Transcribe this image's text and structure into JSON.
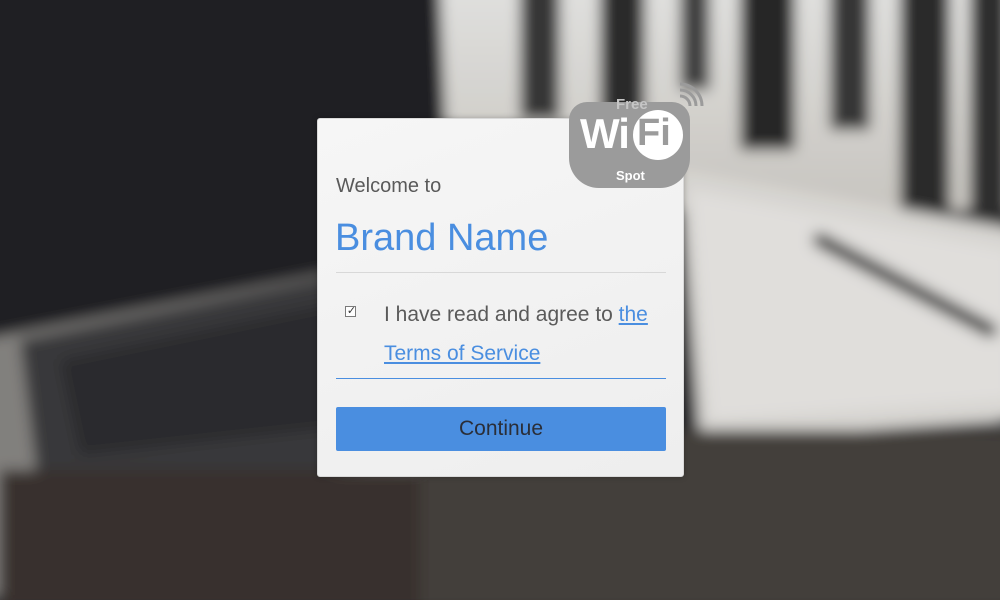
{
  "card": {
    "welcome_text": "Welcome to",
    "brand_name": "Brand Name",
    "terms": {
      "checked": true,
      "prefix": "I have read and agree to ",
      "link_text": "the Terms of Service"
    },
    "continue_label": "Continue"
  },
  "logo": {
    "free": "Free",
    "wi": "Wi",
    "fi": "Fi",
    "spot": "Spot",
    "icon": "wifi-hotspot-icon"
  },
  "colors": {
    "accent": "#4a8ee0",
    "card_bg": "#f3f3f3",
    "text": "#5a5a5a",
    "logo_gray": "#9b9b9b"
  }
}
